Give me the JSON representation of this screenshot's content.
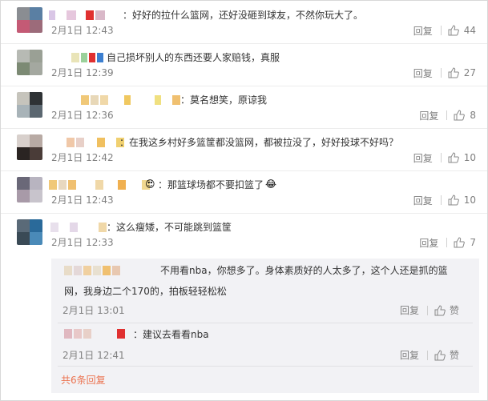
{
  "comments": [
    {
      "text": "：好好的拉什么篮网，还好没砸到球友，不然你玩大了。",
      "time": "2月1日 12:43",
      "reply": "回复",
      "likes": "44"
    },
    {
      "text": "自己损坏别人的东西还要人家赔钱，真服",
      "time": "2月1日 12:39",
      "reply": "回复",
      "likes": "27"
    },
    {
      "text": "：莫名想笑，原谅我",
      "time": "2月1日 12:36",
      "reply": "回复",
      "likes": "8"
    },
    {
      "text": "：在我这乡村好多篮筐都没篮网，都被拉没了，好好投球不好吗？",
      "time": "2月1日 12:42",
      "reply": "回复",
      "likes": "10"
    },
    {
      "text": "：那篮球场都不要扣篮了",
      "time": "2月1日 12:43",
      "reply": "回复",
      "likes": "10"
    },
    {
      "text": "：这么瘦矮，不可能跳到篮筐",
      "time": "2月1日 12:33",
      "reply": "回复",
      "likes": "7"
    }
  ],
  "replies": [
    {
      "line1": "不用看nba，你想多了。身体素质好的人太多了，这个人还是抓的篮",
      "line2": "网，我身边二个170的，拍板轻轻松松",
      "time": "2月1日 13:01",
      "reply": "回复",
      "like": "赞"
    },
    {
      "line1": "：建议去看看nba",
      "time": "2月1日 12:41",
      "reply": "回复",
      "like": "赞"
    }
  ],
  "more_replies": "共6条回复",
  "colors": {
    "accent": "#eb7350",
    "text": "#333333",
    "muted": "#808080",
    "reply_bg": "#f2f2f5"
  },
  "icons": {
    "like": "thumbs-up-icon"
  }
}
